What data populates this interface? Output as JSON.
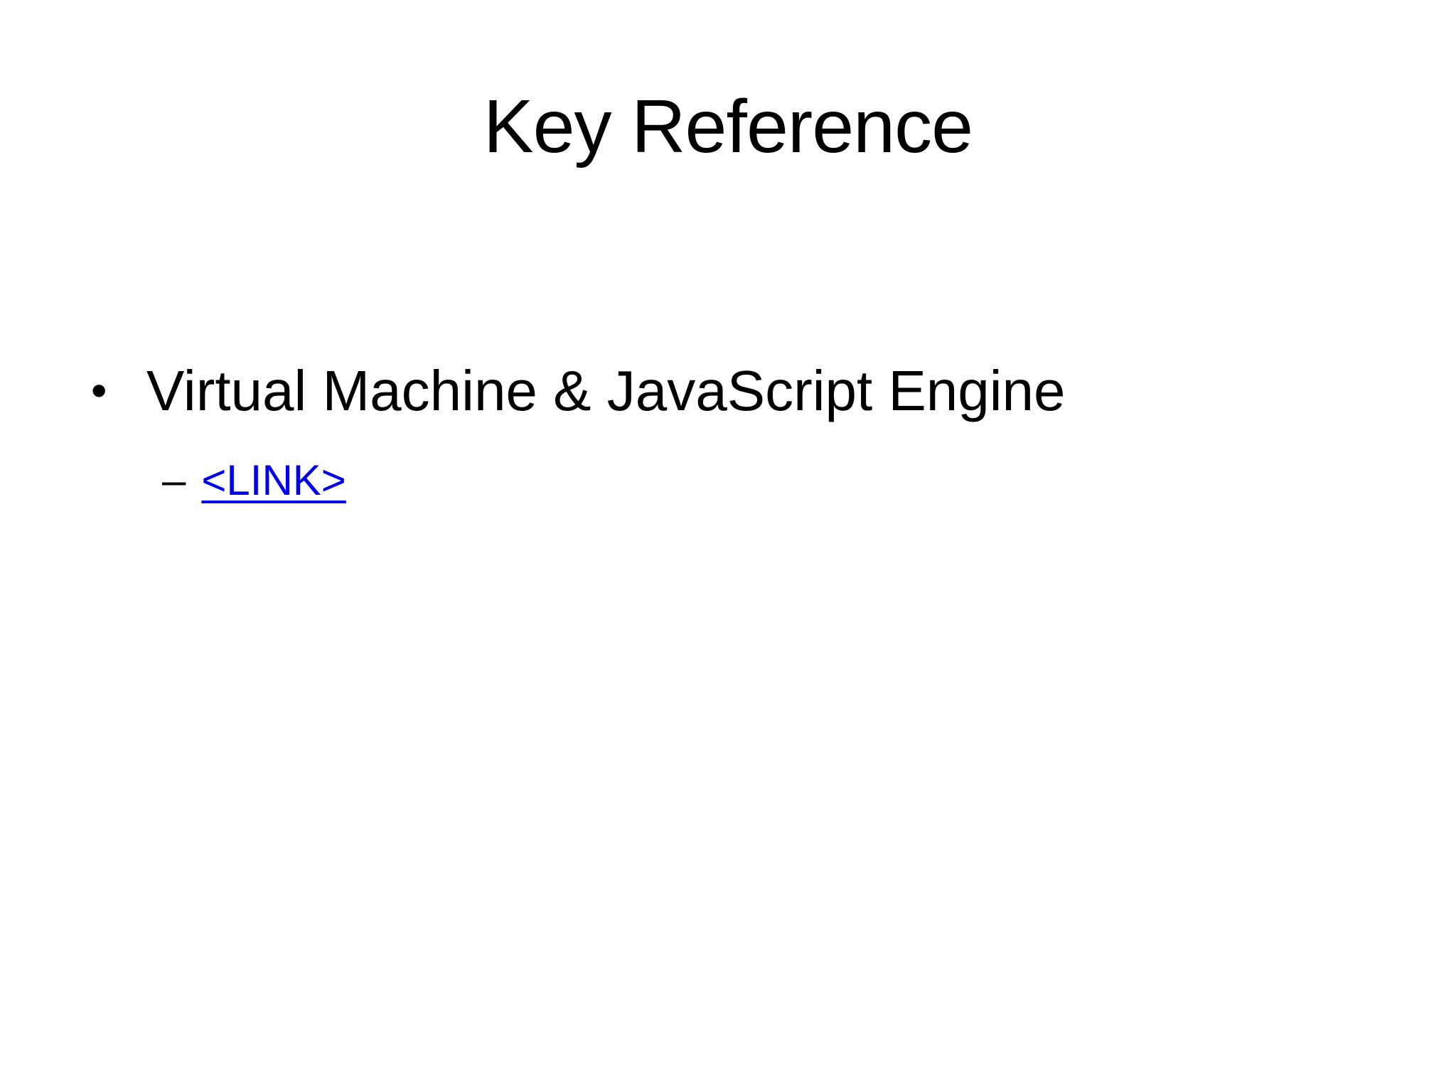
{
  "slide": {
    "title": "Key Reference",
    "bullet": {
      "marker": "•",
      "text": "Virtual Machine & JavaScript Engine"
    },
    "sub_bullet": {
      "marker": "–",
      "link_label": "<LINK>",
      "link_color": "#0000EE"
    },
    "background_color": "#FFFFFF",
    "text_color": "#000000"
  }
}
